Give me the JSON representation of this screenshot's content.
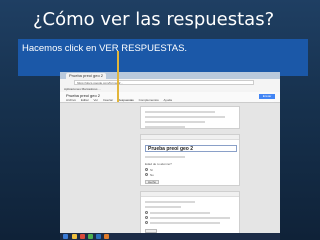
{
  "slide": {
    "title": "¿Cómo ver las respuestas?",
    "caption": "Hacemos click en VER RESPUESTAS."
  },
  "browser": {
    "tab_label": "Prueba preoi geo 2",
    "url": "https://docs.google.com/forms/d/...",
    "bookmarks": "Aplicaciones   Marcadores   ...",
    "doc_title": "Prueba preoi geo 2",
    "menu": [
      "Archivo",
      "Editar",
      "Ver",
      "Insertar",
      "Respuestas",
      "Complementos",
      "Ayuda"
    ],
    "send_label": "Enviar formulario"
  },
  "form": {
    "title": "Prueba preoi geo 2",
    "question": "Edad de tu alumno?",
    "options": [
      "Sí",
      "No"
    ],
    "done_label": "Hecho"
  },
  "colors": {
    "caption_bg": "#1b58a8",
    "pointer": "#e2b63c",
    "slide_bg": "#1f3f63"
  }
}
